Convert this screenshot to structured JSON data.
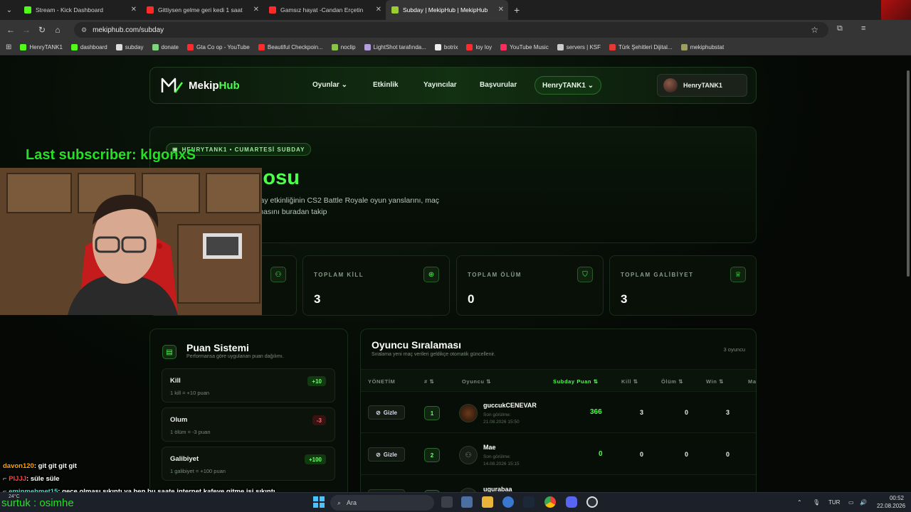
{
  "browser": {
    "tabs": [
      {
        "title": "Stream - Kick Dashboard",
        "color": "#53fc18"
      },
      {
        "title": "Gittiysen gelme geri kedi 1 saat",
        "color": "#ff2b2b"
      },
      {
        "title": "Gamsız hayat -Candan Erçetin",
        "color": "#ff2b2b"
      },
      {
        "title": "Subday | MekipHub | MekipHub",
        "color": "#9acd32"
      }
    ],
    "url": "mekiphub.com/subday",
    "bookmarks": [
      {
        "label": "HenryTANK1",
        "color": "#53fc18"
      },
      {
        "label": "dashboard",
        "color": "#53fc18"
      },
      {
        "label": "subday",
        "color": "#dddddd"
      },
      {
        "label": "donate",
        "color": "#7fd47f"
      },
      {
        "label": "Gta Co op - YouTube",
        "color": "#ff2b2b"
      },
      {
        "label": "Beautiful Checkpoin...",
        "color": "#ff2b2b"
      },
      {
        "label": "noclip",
        "color": "#8bc34a"
      },
      {
        "label": "LightShot tarafında...",
        "color": "#b39ddb"
      },
      {
        "label": "botrix",
        "color": "#eeeeee"
      },
      {
        "label": "loy loy",
        "color": "#ff2b2b"
      },
      {
        "label": "YouTube Music",
        "color": "#ff2b5a"
      },
      {
        "label": "servers | KSF",
        "color": "#cccccc"
      },
      {
        "label": "Türk Şehitleri Dijital...",
        "color": "#e53935"
      },
      {
        "label": "mekiphubstat",
        "color": "#9e9e5e"
      }
    ]
  },
  "nav": {
    "logo_a": "Mekip",
    "logo_b": "Hub",
    "links": [
      "Oyunlar",
      "Etkinlik",
      "Yayıncılar",
      "Başvurular"
    ],
    "user_menu": "HenryTANK1",
    "user_box": "HenryTANK1"
  },
  "hero": {
    "badge": "HENRYTANK1 • CUMARTESİ SUBDAY",
    "title": "Puan Tablosu",
    "desc": "Cumartesi düzenlenen Subday etkinliğinin CS2 Battle Royale oyun yanslarını, maç istatistiklerini ve puan sıralamasını buradan takip"
  },
  "stats": [
    {
      "label": "TOPLAM KİLL",
      "value": "3"
    },
    {
      "label": "TOPLAM ÖLÜM",
      "value": "0"
    },
    {
      "label": "TOPLAM GALİBİYET",
      "value": "3"
    }
  ],
  "points": {
    "title": "Puan Sistemi",
    "subtitle": "Performansa göre uygulanan puan dağılımı.",
    "rules": [
      {
        "name": "Kill",
        "desc": "1 kill = +10 puan",
        "badge": "+10",
        "kind": "pos"
      },
      {
        "name": "Olum",
        "desc": "1 ölüm = -3 puan",
        "badge": "-3",
        "kind": "neg"
      },
      {
        "name": "Galibiyet",
        "desc": "1 galibiyet = +100 puan",
        "badge": "+100",
        "kind": "pos"
      }
    ]
  },
  "ranking": {
    "title": "Oyuncu Sıralaması",
    "subtitle": "Sıralama yeni maç verileri geldikçe otomatik güncellenir.",
    "count": "3 oyuncu",
    "columns": {
      "manage": "YÖNETİM",
      "rank": "# ⇅",
      "player": "Oyuncu ⇅",
      "score": "Subday Puan ⇅",
      "kill": "Kill ⇅",
      "death": "Ölüm ⇅",
      "win": "Win ⇅",
      "more": "Ma"
    },
    "hide_label": "Gizle",
    "rows": [
      {
        "rank": "1",
        "name": "guccukCENEVAR",
        "seen_label": "Son görülme:",
        "seen": "21.08.2026 15:50",
        "score": "366",
        "kill": "3",
        "death": "0",
        "win": "3"
      },
      {
        "rank": "2",
        "name": "Mae",
        "seen_label": "Son görülme:",
        "seen": "14.08.2026 15:15",
        "score": "0",
        "kill": "0",
        "death": "0",
        "win": "0"
      },
      {
        "rank": "",
        "name": "ugurabaa",
        "seen_label": "",
        "seen": "",
        "score": "",
        "kill": "",
        "death": "",
        "win": ""
      }
    ]
  },
  "stream": {
    "last_sub": "Last subscriber: klgonxS",
    "chat": [
      {
        "user": "davon120",
        "msg": ": git git git git",
        "color": "#ffa500"
      },
      {
        "user": "PIJJJ",
        "msg": ": süle süle",
        "color": "#ff4040"
      },
      {
        "user": "eminmehmet15",
        "msg": ": gece olması sıkıntı ya ben bu saate internet kafeye gitme işi sıkıntı",
        "color": "#40e0d0"
      }
    ],
    "follow": "surtuk : osimhe"
  },
  "taskbar": {
    "search": "Ara",
    "weather": "24°C",
    "lang": "TUR",
    "time": "00:52",
    "date": "22.08.2026"
  }
}
